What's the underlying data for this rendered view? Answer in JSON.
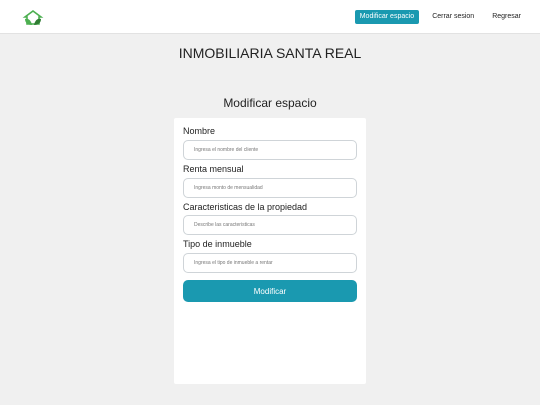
{
  "nav": {
    "logo_icon": "leaf-house-icon",
    "links": [
      {
        "label": "Modificar espacio",
        "active": true
      },
      {
        "label": "Cerrar sesion",
        "active": false
      },
      {
        "label": "Regresar",
        "active": false
      }
    ]
  },
  "brand": {
    "title": "INMOBILIARIA SANTA REAL"
  },
  "page": {
    "title": "Modificar espacio"
  },
  "form": {
    "fields": [
      {
        "label": "Nombre",
        "placeholder": "Ingresa el nombre del cliente",
        "value": ""
      },
      {
        "label": "Renta mensual",
        "placeholder": "Ingresa monto de mensualidad",
        "value": ""
      },
      {
        "label": "Caracteristicas de la propiedad",
        "placeholder": "Describe las caracteristicas",
        "value": ""
      },
      {
        "label": "Tipo de inmueble",
        "placeholder": "Ingresa el tipo de inmueble a rentar",
        "value": ""
      }
    ],
    "submit_label": "Modificar"
  },
  "colors": {
    "accent": "#1a99b0",
    "logo_green": "#4caf50",
    "background": "#f0f0f0"
  }
}
